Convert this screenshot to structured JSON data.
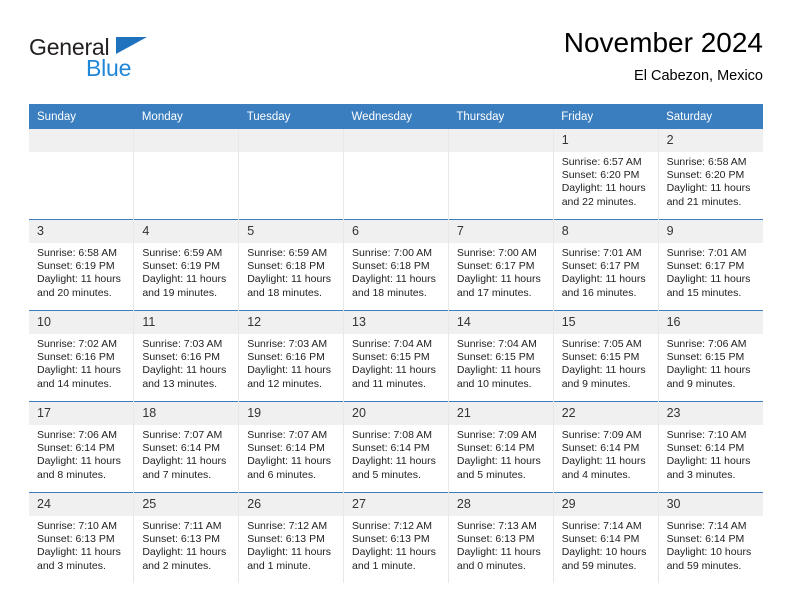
{
  "brand": {
    "name_dark": "General",
    "name_light": "Blue",
    "triangle_icon": "triangle-icon",
    "accent_blue": "#1f87d8",
    "logo_dark": "#231f20"
  },
  "header": {
    "title": "November 2024",
    "subtitle": "El Cabezon, Mexico"
  },
  "theme": {
    "header_bar": "#3a7ebf",
    "daynum_band": "#f0f0f0",
    "row_separator": "#3a7ebf",
    "column_separator": "#e8e8e8"
  },
  "calendar": {
    "weekday_headers": [
      "Sunday",
      "Monday",
      "Tuesday",
      "Wednesday",
      "Thursday",
      "Friday",
      "Saturday"
    ],
    "weeks": [
      [
        {
          "day": "",
          "blank": true,
          "sunrise": "",
          "sunset": "",
          "daylight_1": "",
          "daylight_2": ""
        },
        {
          "day": "",
          "blank": true,
          "sunrise": "",
          "sunset": "",
          "daylight_1": "",
          "daylight_2": ""
        },
        {
          "day": "",
          "blank": true,
          "sunrise": "",
          "sunset": "",
          "daylight_1": "",
          "daylight_2": ""
        },
        {
          "day": "",
          "blank": true,
          "sunrise": "",
          "sunset": "",
          "daylight_1": "",
          "daylight_2": ""
        },
        {
          "day": "",
          "blank": true,
          "sunrise": "",
          "sunset": "",
          "daylight_1": "",
          "daylight_2": ""
        },
        {
          "day": "1",
          "sunrise": "Sunrise: 6:57 AM",
          "sunset": "Sunset: 6:20 PM",
          "daylight_1": "Daylight: 11 hours",
          "daylight_2": "and 22 minutes."
        },
        {
          "day": "2",
          "sunrise": "Sunrise: 6:58 AM",
          "sunset": "Sunset: 6:20 PM",
          "daylight_1": "Daylight: 11 hours",
          "daylight_2": "and 21 minutes."
        }
      ],
      [
        {
          "day": "3",
          "sunrise": "Sunrise: 6:58 AM",
          "sunset": "Sunset: 6:19 PM",
          "daylight_1": "Daylight: 11 hours",
          "daylight_2": "and 20 minutes."
        },
        {
          "day": "4",
          "sunrise": "Sunrise: 6:59 AM",
          "sunset": "Sunset: 6:19 PM",
          "daylight_1": "Daylight: 11 hours",
          "daylight_2": "and 19 minutes."
        },
        {
          "day": "5",
          "sunrise": "Sunrise: 6:59 AM",
          "sunset": "Sunset: 6:18 PM",
          "daylight_1": "Daylight: 11 hours",
          "daylight_2": "and 18 minutes."
        },
        {
          "day": "6",
          "sunrise": "Sunrise: 7:00 AM",
          "sunset": "Sunset: 6:18 PM",
          "daylight_1": "Daylight: 11 hours",
          "daylight_2": "and 18 minutes."
        },
        {
          "day": "7",
          "sunrise": "Sunrise: 7:00 AM",
          "sunset": "Sunset: 6:17 PM",
          "daylight_1": "Daylight: 11 hours",
          "daylight_2": "and 17 minutes."
        },
        {
          "day": "8",
          "sunrise": "Sunrise: 7:01 AM",
          "sunset": "Sunset: 6:17 PM",
          "daylight_1": "Daylight: 11 hours",
          "daylight_2": "and 16 minutes."
        },
        {
          "day": "9",
          "sunrise": "Sunrise: 7:01 AM",
          "sunset": "Sunset: 6:17 PM",
          "daylight_1": "Daylight: 11 hours",
          "daylight_2": "and 15 minutes."
        }
      ],
      [
        {
          "day": "10",
          "sunrise": "Sunrise: 7:02 AM",
          "sunset": "Sunset: 6:16 PM",
          "daylight_1": "Daylight: 11 hours",
          "daylight_2": "and 14 minutes."
        },
        {
          "day": "11",
          "sunrise": "Sunrise: 7:03 AM",
          "sunset": "Sunset: 6:16 PM",
          "daylight_1": "Daylight: 11 hours",
          "daylight_2": "and 13 minutes."
        },
        {
          "day": "12",
          "sunrise": "Sunrise: 7:03 AM",
          "sunset": "Sunset: 6:16 PM",
          "daylight_1": "Daylight: 11 hours",
          "daylight_2": "and 12 minutes."
        },
        {
          "day": "13",
          "sunrise": "Sunrise: 7:04 AM",
          "sunset": "Sunset: 6:15 PM",
          "daylight_1": "Daylight: 11 hours",
          "daylight_2": "and 11 minutes."
        },
        {
          "day": "14",
          "sunrise": "Sunrise: 7:04 AM",
          "sunset": "Sunset: 6:15 PM",
          "daylight_1": "Daylight: 11 hours",
          "daylight_2": "and 10 minutes."
        },
        {
          "day": "15",
          "sunrise": "Sunrise: 7:05 AM",
          "sunset": "Sunset: 6:15 PM",
          "daylight_1": "Daylight: 11 hours",
          "daylight_2": "and 9 minutes."
        },
        {
          "day": "16",
          "sunrise": "Sunrise: 7:06 AM",
          "sunset": "Sunset: 6:15 PM",
          "daylight_1": "Daylight: 11 hours",
          "daylight_2": "and 9 minutes."
        }
      ],
      [
        {
          "day": "17",
          "sunrise": "Sunrise: 7:06 AM",
          "sunset": "Sunset: 6:14 PM",
          "daylight_1": "Daylight: 11 hours",
          "daylight_2": "and 8 minutes."
        },
        {
          "day": "18",
          "sunrise": "Sunrise: 7:07 AM",
          "sunset": "Sunset: 6:14 PM",
          "daylight_1": "Daylight: 11 hours",
          "daylight_2": "and 7 minutes."
        },
        {
          "day": "19",
          "sunrise": "Sunrise: 7:07 AM",
          "sunset": "Sunset: 6:14 PM",
          "daylight_1": "Daylight: 11 hours",
          "daylight_2": "and 6 minutes."
        },
        {
          "day": "20",
          "sunrise": "Sunrise: 7:08 AM",
          "sunset": "Sunset: 6:14 PM",
          "daylight_1": "Daylight: 11 hours",
          "daylight_2": "and 5 minutes."
        },
        {
          "day": "21",
          "sunrise": "Sunrise: 7:09 AM",
          "sunset": "Sunset: 6:14 PM",
          "daylight_1": "Daylight: 11 hours",
          "daylight_2": "and 5 minutes."
        },
        {
          "day": "22",
          "sunrise": "Sunrise: 7:09 AM",
          "sunset": "Sunset: 6:14 PM",
          "daylight_1": "Daylight: 11 hours",
          "daylight_2": "and 4 minutes."
        },
        {
          "day": "23",
          "sunrise": "Sunrise: 7:10 AM",
          "sunset": "Sunset: 6:14 PM",
          "daylight_1": "Daylight: 11 hours",
          "daylight_2": "and 3 minutes."
        }
      ],
      [
        {
          "day": "24",
          "sunrise": "Sunrise: 7:10 AM",
          "sunset": "Sunset: 6:13 PM",
          "daylight_1": "Daylight: 11 hours",
          "daylight_2": "and 3 minutes."
        },
        {
          "day": "25",
          "sunrise": "Sunrise: 7:11 AM",
          "sunset": "Sunset: 6:13 PM",
          "daylight_1": "Daylight: 11 hours",
          "daylight_2": "and 2 minutes."
        },
        {
          "day": "26",
          "sunrise": "Sunrise: 7:12 AM",
          "sunset": "Sunset: 6:13 PM",
          "daylight_1": "Daylight: 11 hours",
          "daylight_2": "and 1 minute."
        },
        {
          "day": "27",
          "sunrise": "Sunrise: 7:12 AM",
          "sunset": "Sunset: 6:13 PM",
          "daylight_1": "Daylight: 11 hours",
          "daylight_2": "and 1 minute."
        },
        {
          "day": "28",
          "sunrise": "Sunrise: 7:13 AM",
          "sunset": "Sunset: 6:13 PM",
          "daylight_1": "Daylight: 11 hours",
          "daylight_2": "and 0 minutes."
        },
        {
          "day": "29",
          "sunrise": "Sunrise: 7:14 AM",
          "sunset": "Sunset: 6:14 PM",
          "daylight_1": "Daylight: 10 hours",
          "daylight_2": "and 59 minutes."
        },
        {
          "day": "30",
          "sunrise": "Sunrise: 7:14 AM",
          "sunset": "Sunset: 6:14 PM",
          "daylight_1": "Daylight: 10 hours",
          "daylight_2": "and 59 minutes."
        }
      ]
    ]
  }
}
